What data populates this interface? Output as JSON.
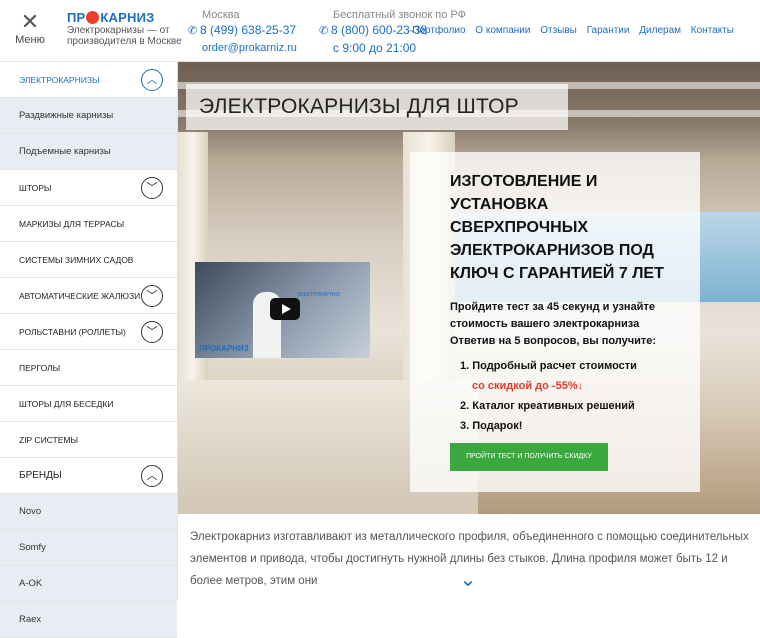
{
  "header": {
    "menu_label": "Меню",
    "logo_name_left": "ПР",
    "logo_name_right": "КАРНИЗ",
    "logo_tagline_1": "Электрокарнизы — от",
    "logo_tagline_2": "производителя в Москве",
    "moscow": {
      "city": "Москва",
      "phone": "8 (499) 638-25-37",
      "email": "order@prokarniz.ru"
    },
    "free": {
      "label": "Бесплатный звонок по РФ",
      "phone": "8 (800) 600-23-38",
      "hours": "с 9:00 до 21:00"
    },
    "nav": [
      "Портфолио",
      "О компании",
      "Отзывы",
      "Гарантии",
      "Дилерам",
      "Контакты"
    ]
  },
  "sidebar": {
    "items": [
      {
        "label": "ЭЛЕКТРОКАРНИЗЫ",
        "toggle": "^"
      },
      {
        "label": "Раздвижные карнизы"
      },
      {
        "label": "Подъемные карнизы"
      },
      {
        "label": "ШТОРЫ",
        "toggle": "v"
      },
      {
        "label": "МАРКИЗЫ ДЛЯ ТЕРРАСЫ"
      },
      {
        "label": "СИСТЕМЫ ЗИМНИХ САДОВ"
      },
      {
        "label": "АВТОМАТИЧЕСКИЕ ЖАЛЮЗИ",
        "toggle": "v"
      },
      {
        "label": "РОЛЬСТАВНИ (РОЛЛЕТЫ)",
        "toggle": "v"
      },
      {
        "label": "ПЕРГОЛЫ"
      },
      {
        "label": "ШТОРЫ ДЛЯ БЕСЕДКИ"
      },
      {
        "label": "ZIP СИСТЕМЫ"
      },
      {
        "label": "БРЕНДЫ",
        "toggle": "^"
      },
      {
        "label": "Novo"
      },
      {
        "label": "Somfy"
      },
      {
        "label": "A-OK"
      },
      {
        "label": "Raex"
      }
    ]
  },
  "hero": {
    "title": "ЭЛЕКТРОКАРНИЗЫ ДЛЯ ШТОР",
    "offer_title": "ИЗГОТОВЛЕНИЕ И УСТАНОВКА СВЕРХПРОЧНЫХ ЭЛЕКТРОКАРНИЗОВ ПОД КЛЮЧ С ГАРАНТИЕЙ 7 ЛЕТ",
    "offer_intro": "Пройдите тест за 45 секунд и узнайте стоимость вашего электрокарниза Ответив на 5 вопросов, вы получите:",
    "list": [
      "1. Подробный расчет стоимости",
      "со скидкой до -55%↓",
      "2. Каталог креативных решений",
      "3. Подарок!"
    ],
    "cta_label": "ПРОЙТИ ТЕСТ И ПОЛУЧИТЬ СКИДКУ",
    "video_logo": "ПРОКАРНИЗ",
    "video_caption": "ЭЛЕКТРОКАРНИЗ"
  },
  "description": "Электрокарниз изготавливают из металлического профиля, объединенного с помощью соединительных элементов и привода, чтобы достигнуть нужной длины без стыков. Длина профиля может быть 12 и более метров, этим они",
  "colors": {
    "accent": "#1a6fc4",
    "cta": "#3aa83e",
    "discount": "#e03a2a"
  }
}
